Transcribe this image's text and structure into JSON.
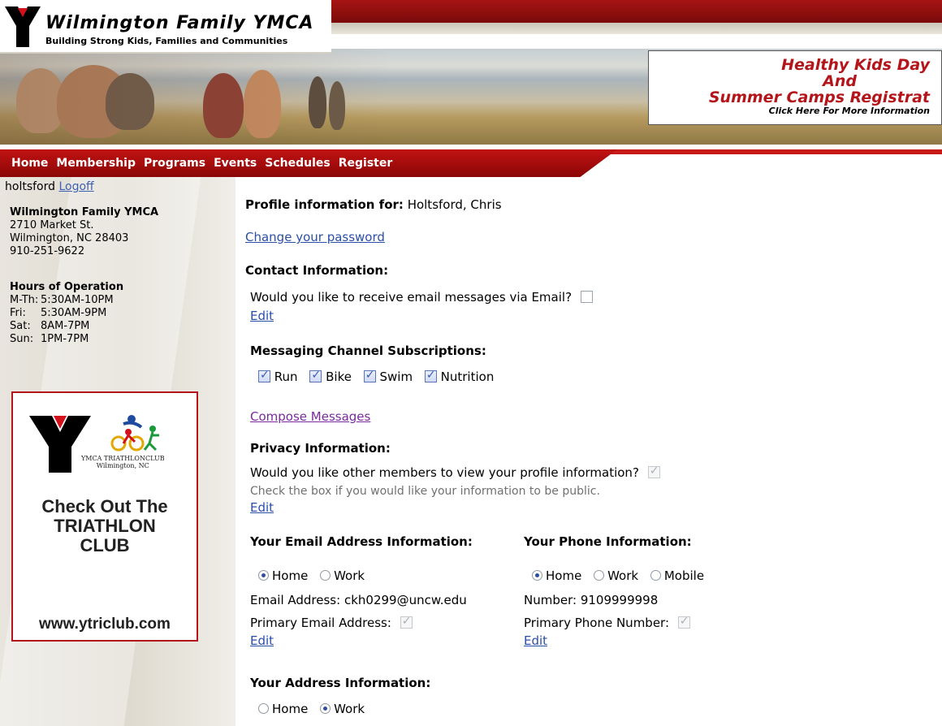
{
  "header": {
    "org_name": "Wilmington Family YMCA",
    "tagline": "Building Strong Kids, Families and Communities",
    "promo": {
      "line1": "Healthy Kids Day",
      "line2": "And",
      "line3": "Summer Camps Registrat",
      "line4": "Click Here For More Information"
    }
  },
  "nav": {
    "items": [
      "Home",
      "Membership",
      "Programs",
      "Events",
      "Schedules",
      "Register"
    ]
  },
  "sidebar": {
    "username": "holtsford",
    "logoff": "Logoff",
    "branch": {
      "name": "Wilmington Family YMCA",
      "street": "2710 Market St.",
      "city": "Wilmington, NC 28403",
      "phone": "910-251-9622"
    },
    "hours": {
      "title": "Hours of Operation",
      "rows": [
        {
          "day": "M-Th:",
          "time": "5:30AM-10PM"
        },
        {
          "day": "Fri:",
          "time": "5:30AM-9PM"
        },
        {
          "day": "Sat:",
          "time": "8AM-7PM"
        },
        {
          "day": "Sun:",
          "time": "1PM-7PM"
        }
      ]
    },
    "ad": {
      "club_line1": "YMCA TRIATHLONCLUB",
      "club_line2": "Wilmington, NC",
      "heading_line1": "Check Out The",
      "heading_line2": "TRIATHLON",
      "heading_line3": "CLUB",
      "url": "www.ytriclub.com"
    }
  },
  "main": {
    "profile_label": "Profile information for:",
    "profile_name": "Holtsford, Chris",
    "change_password": "Change your password",
    "contact": {
      "heading": "Contact Information:",
      "question": "Would you like to receive email messages via Email?",
      "checked": false,
      "edit": "Edit"
    },
    "channels": {
      "heading": "Messaging Channel Subscriptions:",
      "items": [
        {
          "label": "Run",
          "checked": true
        },
        {
          "label": "Bike",
          "checked": true
        },
        {
          "label": "Swim",
          "checked": true
        },
        {
          "label": "Nutrition",
          "checked": true
        }
      ]
    },
    "compose": "Compose Messages",
    "privacy": {
      "heading": "Privacy Information:",
      "question": "Would you like other members to view your profile information?",
      "checked": true,
      "hint": "Check the box if you would like your information to be public.",
      "edit": "Edit"
    },
    "email": {
      "heading": "Your Email Address Information:",
      "options": [
        "Home",
        "Work"
      ],
      "selected": "Home",
      "address_label": "Email Address:",
      "address": "ckh0299@uncw.edu",
      "primary_label": "Primary Email Address:",
      "primary_checked": true,
      "edit": "Edit"
    },
    "phone": {
      "heading": "Your Phone Information:",
      "options": [
        "Home",
        "Work",
        "Mobile"
      ],
      "selected": "Home",
      "number_label": "Number:",
      "number": "9109999998",
      "primary_label": "Primary Phone Number:",
      "primary_checked": true,
      "edit": "Edit"
    },
    "address": {
      "heading": "Your Address Information:",
      "options": [
        "Home",
        "Work"
      ],
      "selected": "Work"
    }
  }
}
